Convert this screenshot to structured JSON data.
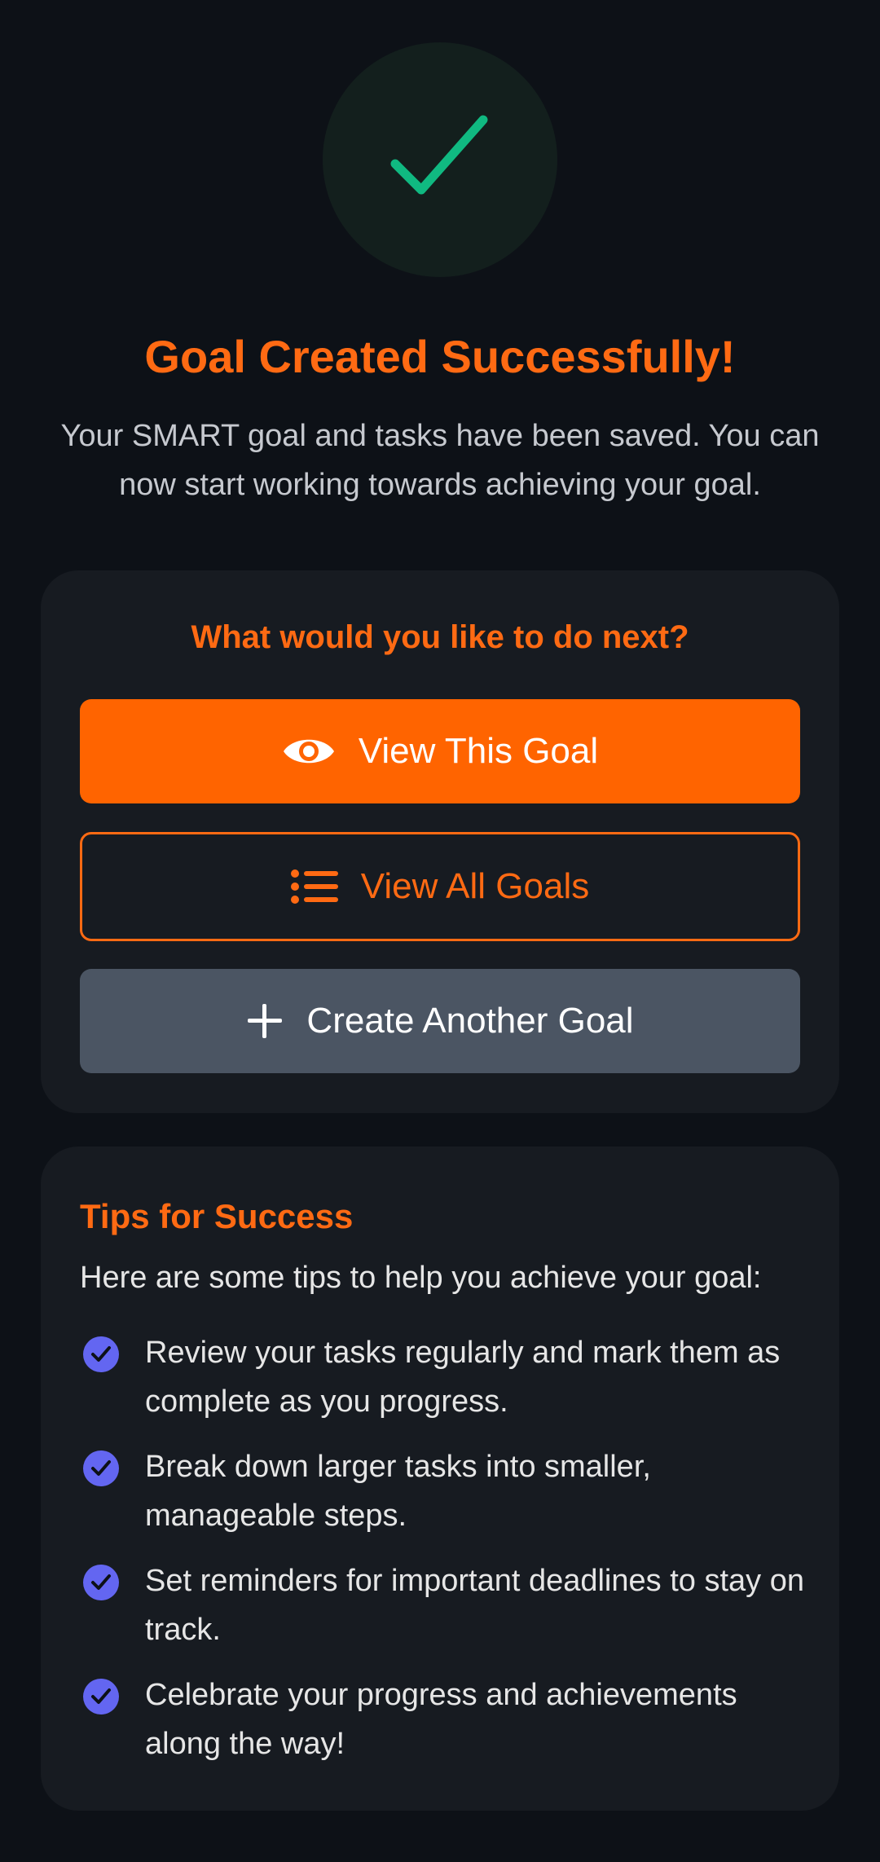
{
  "header": {
    "icon": "check-icon",
    "title": "Goal Created Successfully!",
    "subtitle": "Your SMART goal and tasks have been saved. You can now start working towards achieving your goal."
  },
  "next": {
    "heading": "What would you like to do next?",
    "buttons": [
      {
        "label": "View This Goal",
        "icon": "eye-icon"
      },
      {
        "label": "View All Goals",
        "icon": "list-icon"
      },
      {
        "label": "Create Another Goal",
        "icon": "plus-icon"
      }
    ]
  },
  "tips": {
    "heading": "Tips for Success",
    "intro": "Here are some tips to help you achieve your goal:",
    "items": [
      "Review your tasks regularly and mark them as complete as you progress.",
      "Break down larger tasks into smaller, manageable steps.",
      "Set reminders for important deadlines to stay on track.",
      "Celebrate your progress and achievements along the way!"
    ]
  },
  "colors": {
    "background": "#0d1117",
    "card": "#171b21",
    "accent": "#ff6a13",
    "success": "#10b981",
    "check_badge": "#6366f1",
    "secondary_button": "#4b5563"
  }
}
